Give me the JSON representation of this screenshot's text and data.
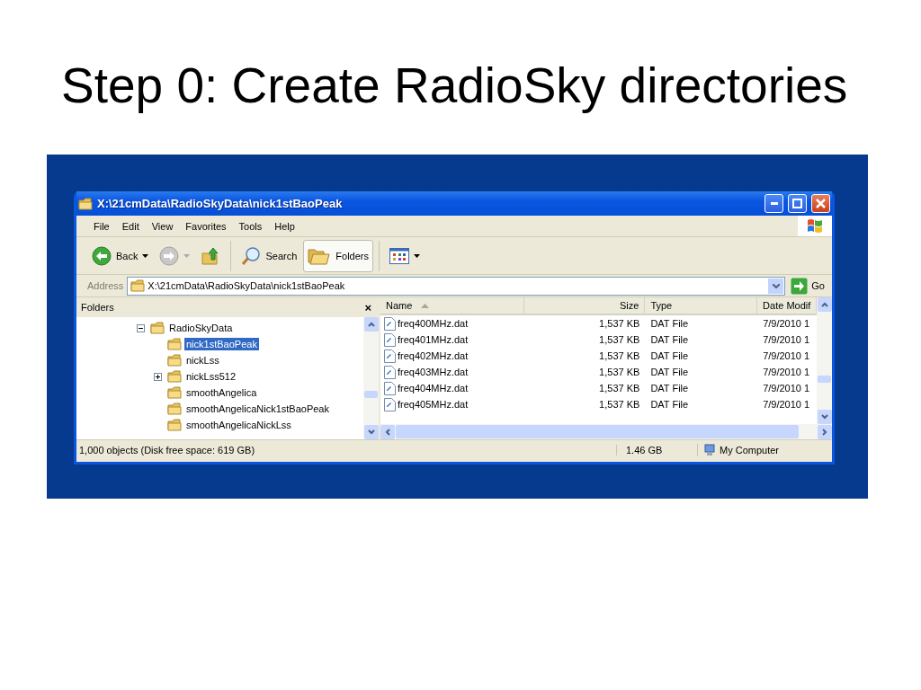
{
  "slide": {
    "title": "Step 0: Create RadioSky directories"
  },
  "window": {
    "title": "X:\\21cmData\\RadioSkyData\\nick1stBaoPeak"
  },
  "menu": [
    "File",
    "Edit",
    "View",
    "Favorites",
    "Tools",
    "Help"
  ],
  "toolbar": [
    {
      "kind": "back",
      "label": "Back",
      "pressed": false
    },
    {
      "kind": "forward",
      "pressed": false
    },
    {
      "kind": "up",
      "pressed": false
    },
    {
      "kind": "search",
      "label": "Search",
      "pressed": false
    },
    {
      "kind": "folders",
      "label": "Folders",
      "pressed": true
    },
    {
      "kind": "views",
      "pressed": false
    }
  ],
  "address": {
    "label": "Address",
    "value": "X:\\21cmData\\RadioSkyData\\nick1stBaoPeak",
    "go": "Go"
  },
  "folders_pane": {
    "title": "Folders",
    "close": "×"
  },
  "tree": [
    {
      "label": "RadioSkyData",
      "expanded": true,
      "selected": false,
      "children": [
        {
          "label": "nick1stBaoPeak",
          "selected": true
        },
        {
          "label": "nickLss",
          "selected": false
        },
        {
          "label": "nickLss512",
          "expanded": false,
          "selected": false
        },
        {
          "label": "smoothAngelica",
          "selected": false
        },
        {
          "label": "smoothAngelicaNick1stBaoPeak",
          "selected": false
        },
        {
          "label": "smoothAngelicaNickLss",
          "selected": false
        }
      ]
    }
  ],
  "files": {
    "columns": [
      {
        "label": "Name",
        "sorted": true
      },
      {
        "label": "Size",
        "sorted": false
      },
      {
        "label": "Type",
        "sorted": false
      },
      {
        "label": "Date Modif",
        "sorted": false
      }
    ],
    "rows": [
      {
        "name": "freq400MHz.dat",
        "size": "1,537 KB",
        "type": "DAT File",
        "date": "7/9/2010 1"
      },
      {
        "name": "freq401MHz.dat",
        "size": "1,537 KB",
        "type": "DAT File",
        "date": "7/9/2010 1"
      },
      {
        "name": "freq402MHz.dat",
        "size": "1,537 KB",
        "type": "DAT File",
        "date": "7/9/2010 1"
      },
      {
        "name": "freq403MHz.dat",
        "size": "1,537 KB",
        "type": "DAT File",
        "date": "7/9/2010 1"
      },
      {
        "name": "freq404MHz.dat",
        "size": "1,537 KB",
        "type": "DAT File",
        "date": "7/9/2010 1"
      },
      {
        "name": "freq405MHz.dat",
        "size": "1,537 KB",
        "type": "DAT File",
        "date": "7/9/2010 1"
      }
    ]
  },
  "status_bar": {
    "objects": "1,000 objects (Disk free space: 619 GB)",
    "size": "1.46 GB",
    "zone": "My Computer"
  }
}
